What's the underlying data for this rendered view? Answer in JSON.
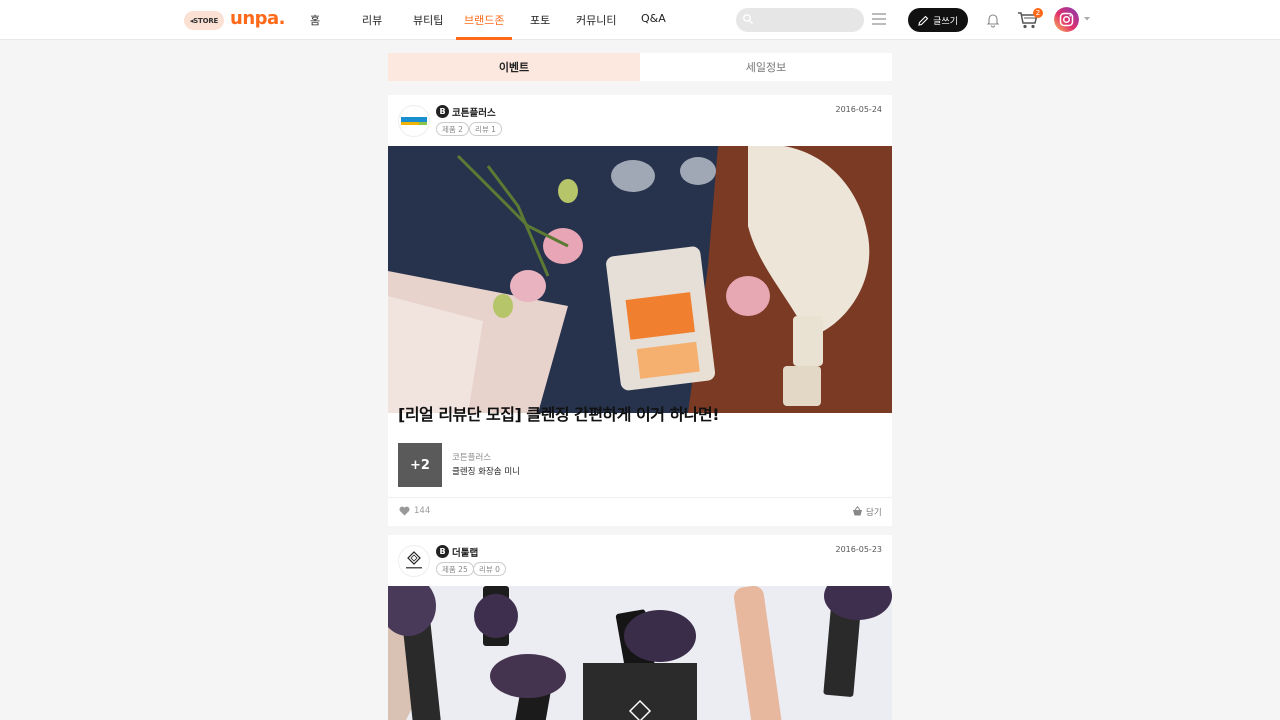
{
  "header": {
    "store_label": "◂STORE",
    "logo": "unpa.",
    "nav": [
      "홈",
      "리뷰",
      "뷰티팁",
      "브랜드존",
      "포토",
      "커뮤니티",
      "Q&A"
    ],
    "active_nav": "브랜드존",
    "search_placeholder": "",
    "write_label": "글쓰기",
    "cart_count": "2",
    "accent": "#ff6a1a"
  },
  "tabs": [
    "이벤트",
    "세일정보"
  ],
  "posts": [
    {
      "brand": "코튼플러스",
      "badge": "B",
      "chips": [
        "제품 2",
        "리뷰 1"
      ],
      "date": "2016-05-24",
      "title": "[리얼 리뷰단 모집] 클렌징 간편하게 이거 하나면!",
      "product_more": "+2",
      "product_brand": "코튼플러스",
      "product_name": "클렌징 화장솜 미니",
      "likes": "144",
      "save_label": "담기"
    },
    {
      "brand": "더툴랩",
      "badge": "B",
      "chips": [
        "제품 25",
        "리뷰 0"
      ],
      "date": "2016-05-23"
    }
  ]
}
